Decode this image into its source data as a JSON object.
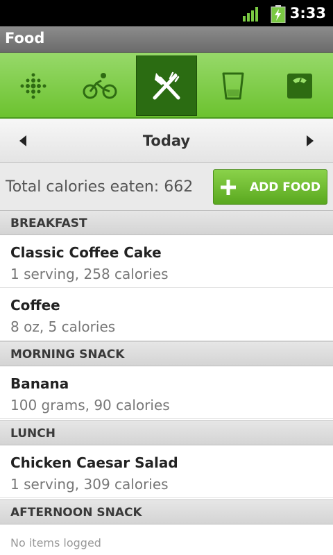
{
  "status_bar": {
    "time": "3:33"
  },
  "title_bar": {
    "title": "Food"
  },
  "tabs": [
    {
      "icon": "dots-icon"
    },
    {
      "icon": "bicycle-icon"
    },
    {
      "icon": "fork-knife-icon",
      "active": true
    },
    {
      "icon": "glass-icon"
    },
    {
      "icon": "scale-icon"
    }
  ],
  "date_nav": {
    "label": "Today"
  },
  "summary": {
    "total_text": "Total calories eaten: 662",
    "add_label": "ADD FOOD"
  },
  "sections": [
    {
      "title": "BREAKFAST",
      "items": [
        {
          "name": "Classic Coffee Cake",
          "detail": "1 serving, 258 calories"
        },
        {
          "name": "Coffee",
          "detail": "8 oz, 5 calories"
        }
      ]
    },
    {
      "title": "MORNING SNACK",
      "items": [
        {
          "name": "Banana",
          "detail": "100 grams, 90 calories"
        }
      ]
    },
    {
      "title": "LUNCH",
      "items": [
        {
          "name": "Chicken Caesar Salad",
          "detail": "1 serving, 309 calories"
        }
      ]
    },
    {
      "title": "AFTERNOON SNACK",
      "empty_text": "No items logged"
    }
  ],
  "colors": {
    "accent_green": "#6cc22f",
    "active_tab": "#2b6c12"
  }
}
